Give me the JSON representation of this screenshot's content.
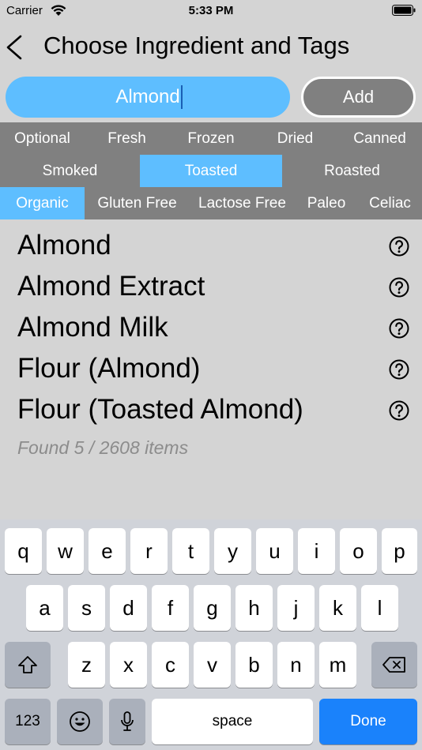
{
  "status_bar": {
    "carrier": "Carrier",
    "time": "5:33 PM"
  },
  "nav": {
    "title": "Choose Ingredient and Tags"
  },
  "search": {
    "value": "Almond",
    "add_label": "Add"
  },
  "tags": {
    "row1": [
      "Optional",
      "Fresh",
      "Frozen",
      "Dried",
      "Canned"
    ],
    "row2": [
      "Smoked",
      "Toasted",
      "Roasted"
    ],
    "row3": [
      "Organic",
      "Gluten Free",
      "Lactose Free",
      "Paleo",
      "Celiac"
    ],
    "selected": [
      "Toasted",
      "Organic"
    ]
  },
  "results": {
    "items": [
      "Almond",
      "Almond Extract",
      "Almond Milk",
      "Flour (Almond)",
      "Flour (Toasted Almond)"
    ],
    "found_text": "Found 5 / 2608 items"
  },
  "keyboard": {
    "row1": [
      "q",
      "w",
      "e",
      "r",
      "t",
      "y",
      "u",
      "i",
      "o",
      "p"
    ],
    "row2": [
      "a",
      "s",
      "d",
      "f",
      "g",
      "h",
      "j",
      "k",
      "l"
    ],
    "row3": [
      "z",
      "x",
      "c",
      "v",
      "b",
      "n",
      "m"
    ],
    "numbers_label": "123",
    "space_label": "space",
    "done_label": "Done"
  },
  "colors": {
    "accent": "#5ebeff",
    "tag_bar": "#808080",
    "done": "#1a82fb"
  }
}
